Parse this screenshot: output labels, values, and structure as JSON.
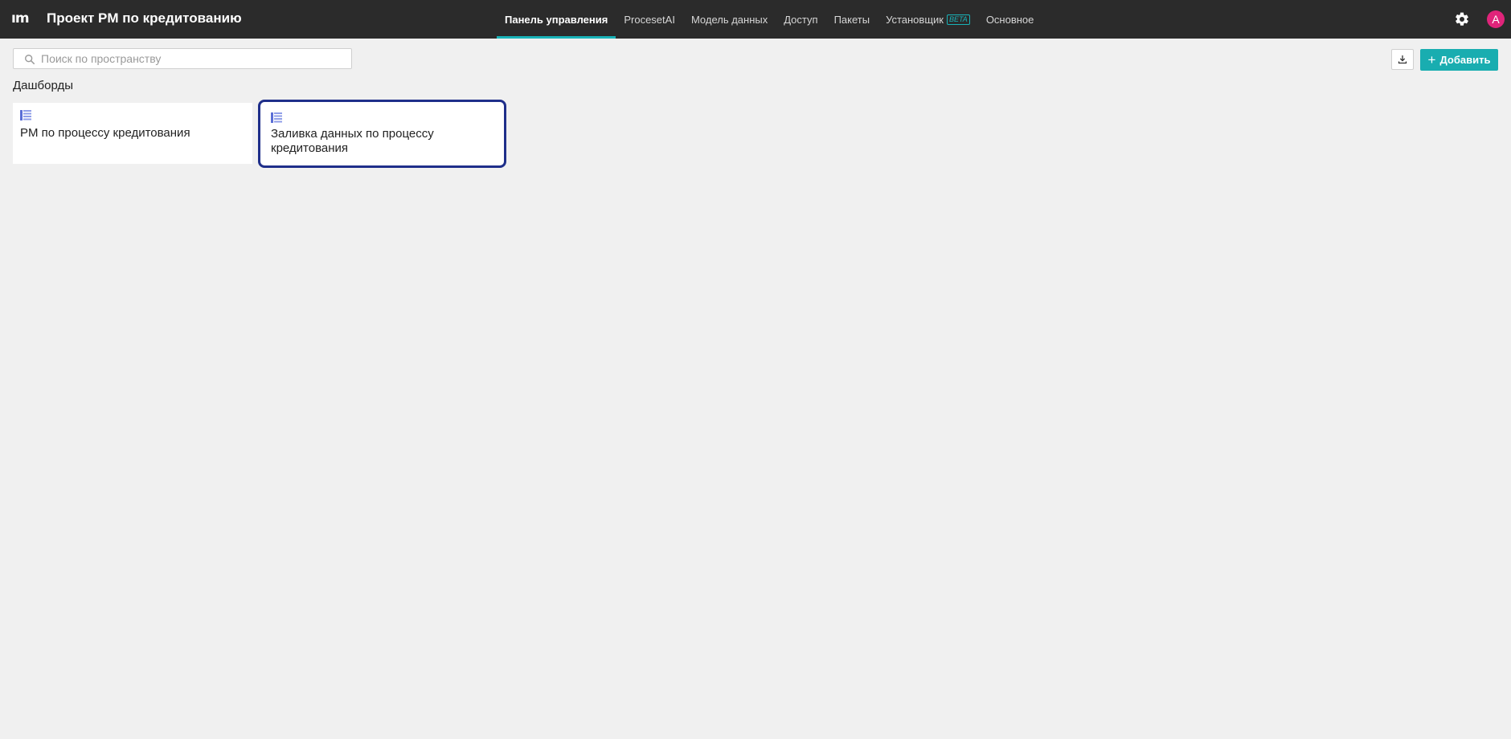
{
  "header": {
    "logo_text": "ım",
    "project_title": "Проект PM по кредитованию",
    "tabs": [
      {
        "label": "Панель управления",
        "active": true
      },
      {
        "label": "ProcesetAI",
        "active": false
      },
      {
        "label": "Модель данных",
        "active": false
      },
      {
        "label": "Доступ",
        "active": false
      },
      {
        "label": "Пакеты",
        "active": false
      },
      {
        "label": "Установщик",
        "badge": "BETA",
        "active": false
      },
      {
        "label": "Основное",
        "active": false
      }
    ],
    "settings_icon": "gear-icon",
    "avatar_letter": "A",
    "avatar_color": "#e0247a",
    "accent_color": "#19b3b8"
  },
  "toolbar": {
    "search_placeholder": "Поиск по пространству",
    "search_value": "",
    "download_icon": "download-icon",
    "add_label": "Добавить"
  },
  "section": {
    "title": "Дашборды"
  },
  "dashboards": [
    {
      "label": "PM по процессу кредитования",
      "icon": "dashboard-icon",
      "selected": false
    },
    {
      "label": "Заливка данных по процессу кредитования",
      "icon": "dashboard-icon",
      "selected": true
    }
  ]
}
